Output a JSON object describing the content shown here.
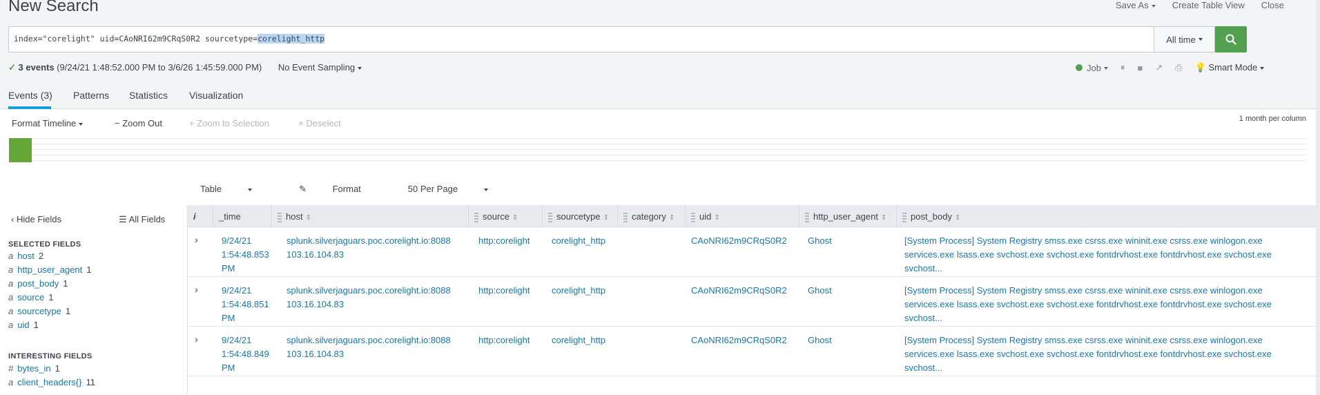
{
  "header": {
    "title": "New Search",
    "save_as": "Save As",
    "create_table_view": "Create Table View",
    "close": "Close"
  },
  "search": {
    "query_prefix": "index=\"corelight\" uid=CAoNRI62m9CRqS0R2 sourcetype=",
    "query_selected": "corelight_http",
    "time_range": "All time"
  },
  "status": {
    "events_count": "3 events",
    "range": "(9/24/21 1:48:52.000 PM to 3/6/26 1:45:59.000 PM)",
    "sampling": "No Event Sampling",
    "job": "Job",
    "mode": "Smart Mode"
  },
  "tabs": [
    "Events (3)",
    "Patterns",
    "Statistics",
    "Visualization"
  ],
  "timeline": {
    "format": "Format Timeline",
    "zoom_out": "Zoom Out",
    "zoom_selection": "Zoom to Selection",
    "deselect": "Deselect",
    "per_column": "1 month per column"
  },
  "results_toolbar": {
    "view": "Table",
    "format": "Format",
    "per_page": "50 Per Page"
  },
  "sidebar": {
    "hide_fields": "Hide Fields",
    "all_fields": "All Fields",
    "selected_heading": "SELECTED FIELDS",
    "selected": [
      {
        "type": "a",
        "name": "host",
        "count": "2"
      },
      {
        "type": "a",
        "name": "http_user_agent",
        "count": "1"
      },
      {
        "type": "a",
        "name": "post_body",
        "count": "1"
      },
      {
        "type": "a",
        "name": "source",
        "count": "1"
      },
      {
        "type": "a",
        "name": "sourcetype",
        "count": "1"
      },
      {
        "type": "a",
        "name": "uid",
        "count": "1"
      }
    ],
    "interesting_heading": "INTERESTING FIELDS",
    "interesting": [
      {
        "type": "#",
        "name": "bytes_in",
        "count": "1"
      },
      {
        "type": "a",
        "name": "client_headers{}",
        "count": "11"
      }
    ]
  },
  "table": {
    "columns": [
      "i",
      "_time",
      "host",
      "source",
      "sourcetype",
      "category",
      "uid",
      "http_user_agent",
      "post_body"
    ],
    "rows": [
      {
        "time_1": "9/24/21",
        "time_2": "1:54:48.853",
        "time_3": "PM",
        "host_1": "splunk.silverjaguars.poc.corelight.io:8088",
        "host_2": "103.16.104.83",
        "source": "http:corelight",
        "sourcetype": "corelight_http",
        "category": "",
        "uid": "CAoNRI62m9CRqS0R2",
        "agent": "Ghost",
        "body_1": "[System Process] System Registry smss.exe csrss.exe wininit.exe csrss.exe winlogon.exe",
        "body_2": "services.exe lsass.exe svchost.exe svchost.exe fontdrvhost.exe fontdrvhost.exe svchost.exe",
        "body_3": "svchost..."
      },
      {
        "time_1": "9/24/21",
        "time_2": "1:54:48.851",
        "time_3": "PM",
        "host_1": "splunk.silverjaguars.poc.corelight.io:8088",
        "host_2": "103.16.104.83",
        "source": "http:corelight",
        "sourcetype": "corelight_http",
        "category": "",
        "uid": "CAoNRI62m9CRqS0R2",
        "agent": "Ghost",
        "body_1": "[System Process] System Registry smss.exe csrss.exe wininit.exe csrss.exe winlogon.exe",
        "body_2": "services.exe lsass.exe svchost.exe svchost.exe fontdrvhost.exe fontdrvhost.exe svchost.exe",
        "body_3": "svchost..."
      },
      {
        "time_1": "9/24/21",
        "time_2": "1:54:48.849",
        "time_3": "PM",
        "host_1": "splunk.silverjaguars.poc.corelight.io:8088",
        "host_2": "103.16.104.83",
        "source": "http:corelight",
        "sourcetype": "corelight_http",
        "category": "",
        "uid": "CAoNRI62m9CRqS0R2",
        "agent": "Ghost",
        "body_1": "[System Process] System Registry smss.exe csrss.exe wininit.exe csrss.exe winlogon.exe",
        "body_2": "services.exe lsass.exe svchost.exe svchost.exe fontdrvhost.exe fontdrvhost.exe svchost.exe",
        "body_3": "svchost..."
      }
    ]
  },
  "colors": {
    "accent": "#1a9cd6",
    "search_button": "#53a051",
    "link": "#1a78a6",
    "timeline_bar": "#65a637"
  }
}
